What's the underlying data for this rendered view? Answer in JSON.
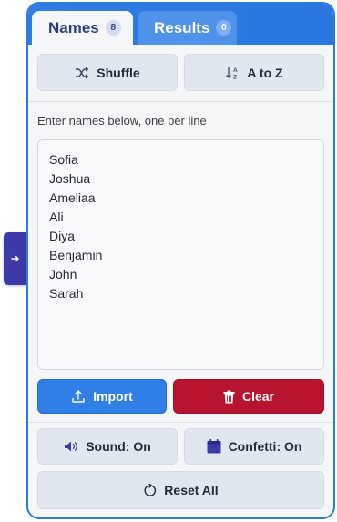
{
  "tabs": [
    {
      "label": "Names",
      "count": "8"
    },
    {
      "label": "Results",
      "count": "0"
    }
  ],
  "actions": {
    "shuffle_label": "Shuffle",
    "sort_label": "A to Z"
  },
  "hint": "Enter names below, one per line",
  "names": [
    "Sofia",
    "Joshua",
    "Ameliaa",
    "Ali",
    "Diya",
    "Benjamin",
    "John",
    "Sarah"
  ],
  "buttons": {
    "import_label": "Import",
    "clear_label": "Clear",
    "sound_label": "Sound: On",
    "confetti_label": "Confetti: On",
    "reset_label": "Reset All"
  },
  "colors": {
    "accent_blue": "#2f7fe6",
    "danger_red": "#b8142f",
    "sidebar_purple": "#3b3aa8"
  },
  "icons": {
    "toggle": "arrow-right-icon",
    "shuffle": "shuffle-icon",
    "sort": "sort-az-icon",
    "import": "upload-icon",
    "clear": "trash-icon",
    "sound": "speaker-icon",
    "confetti": "calendar-icon",
    "reset": "reset-icon"
  }
}
